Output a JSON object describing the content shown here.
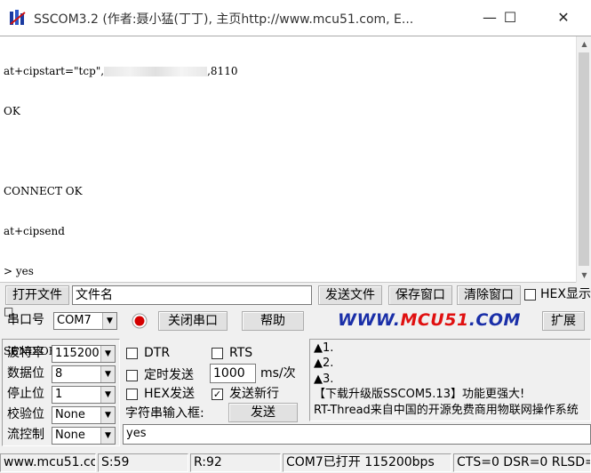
{
  "window": {
    "title": "SSCOM3.2 (作者:聂小猛(丁丁), 主页http://www.mcu51.com,  E...",
    "minimize_glyph": "—",
    "maximize_glyph": "☐",
    "close_glyph": "✕"
  },
  "terminal": {
    "lines": [
      {
        "before": "at+cipstart=\"tcp\",",
        "after": ",8110"
      },
      "OK",
      "",
      "CONNECT OK",
      "at+cipsend",
      "> yes",
      "□",
      "SEND OK"
    ]
  },
  "file_row": {
    "open_file_label": "打开文件",
    "file_name_value": "文件名",
    "send_file_label": "发送文件",
    "save_window_label": "保存窗口",
    "clear_window_label": "清除窗口",
    "hex_display_label": "HEX显示"
  },
  "port_row": {
    "port_label": "串口号",
    "port_value": "COM7",
    "close_port_label": "关闭串口",
    "help_label": "帮助",
    "logo_prefix": "WWW.",
    "logo_brand": "MCU51",
    "logo_suffix": ".COM",
    "expand_label": "扩展"
  },
  "settings": {
    "baud_label": "波特率",
    "baud_value": "115200",
    "data_bits_label": "数据位",
    "data_bits_value": "8",
    "stop_bits_label": "停止位",
    "stop_bits_value": "1",
    "parity_label": "校验位",
    "parity_value": "None",
    "flow_label": "流控制",
    "flow_value": "None"
  },
  "options": {
    "dtr_label": "DTR",
    "rts_label": "RTS",
    "timed_send_label": "定时发送",
    "interval_value": "1000",
    "interval_unit": "ms/次",
    "hex_send_label": "HEX发送",
    "send_newline_label": "发送新行",
    "send_newline_checked": "✓",
    "string_input_label": "字符串输入框:",
    "send_label": "发送",
    "send_value": "yes"
  },
  "info_panel": {
    "lines": [
      "▲1.",
      "▲2.",
      "▲3.",
      "【下载升级版SSCOM5.13】功能更强大!",
      "RT-Thread来自中国的开源免费商用物联网操作系统"
    ]
  },
  "statusbar": {
    "website": "www.mcu51.com",
    "sent": "S:59",
    "received": "R:92",
    "port_status": "COM7已打开  115200bps",
    "signals": "CTS=0 DSR=0 RLSD=0"
  },
  "colors": {
    "logo_blue": "#1a2fa8",
    "logo_red": "#e01010",
    "record_red": "#d40000"
  }
}
